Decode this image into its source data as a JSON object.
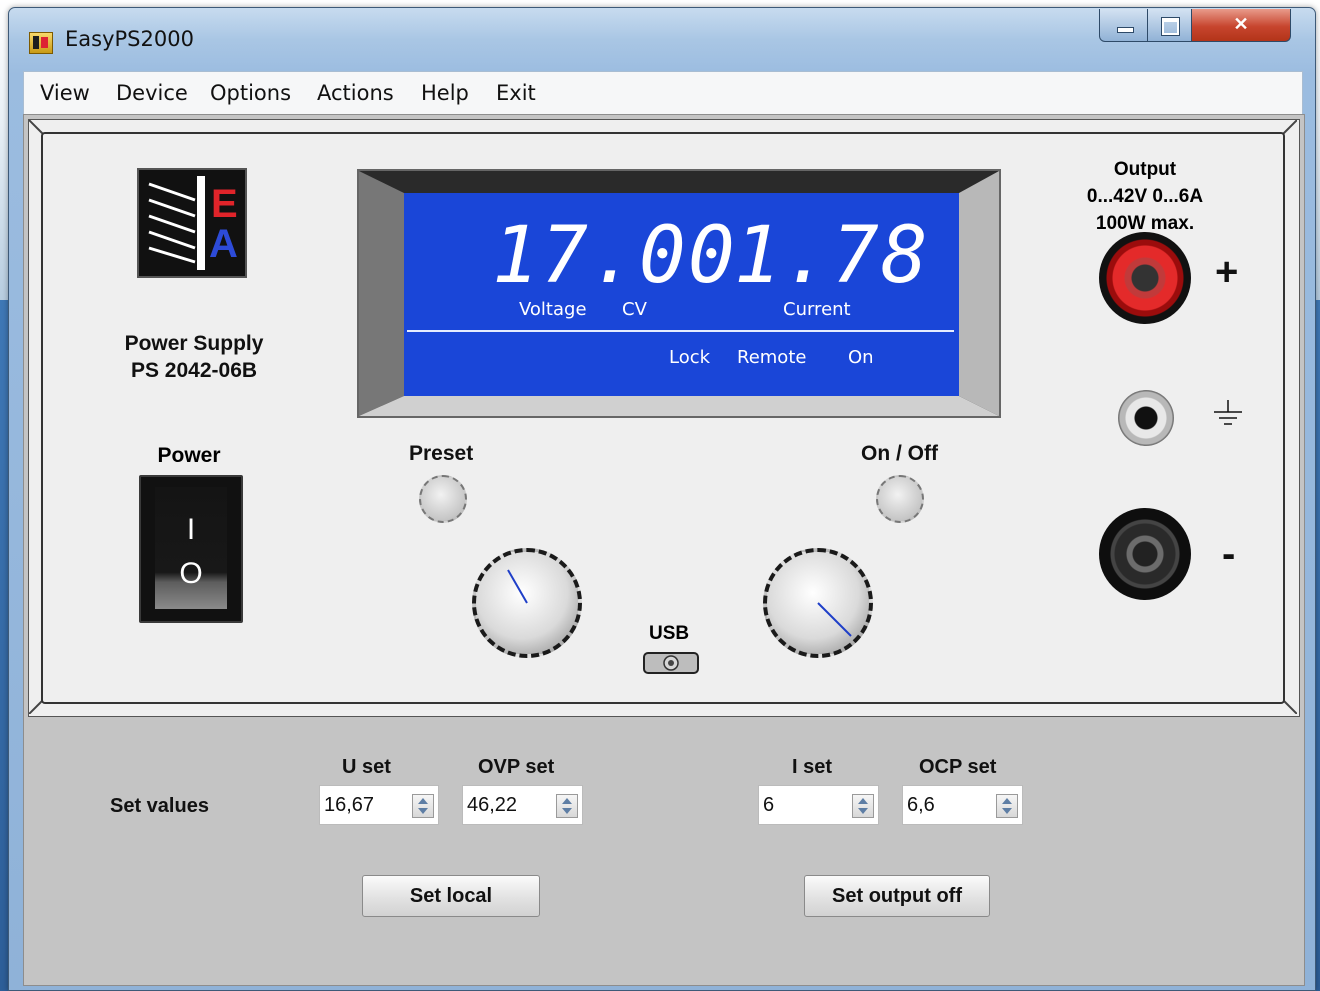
{
  "window": {
    "title": "EasyPS2000"
  },
  "menu": [
    "View",
    "Device",
    "Options",
    "Actions",
    "Help",
    "Exit"
  ],
  "device": {
    "brand_letters": {
      "top": "E",
      "bottom": "A"
    },
    "name_line1": "Power Supply",
    "name_line2": "PS 2042-06B",
    "power_label": "Power",
    "switch_on_symbol": "I",
    "switch_off_symbol": "O",
    "output_line1": "Output",
    "output_line2": "0...42V 0...6A",
    "output_line3": "100W max.",
    "plus_sign": "+",
    "minus_sign": "-",
    "preset_label": "Preset",
    "onoff_label": "On / Off",
    "usb_label": "USB"
  },
  "display": {
    "voltage": "17.00",
    "current": "1.78",
    "voltage_label": "Voltage",
    "mode_label": "CV",
    "current_label": "Current",
    "lock_label": "Lock",
    "remote_label": "Remote",
    "on_label": "On",
    "color": "#1a46d8"
  },
  "set_values": {
    "label": "Set values",
    "u_set_label": "U set",
    "u_set_value": "16,67",
    "ovp_set_label": "OVP set",
    "ovp_set_value": "46,22",
    "i_set_label": "I set",
    "i_set_value": "6",
    "ocp_set_label": "OCP set",
    "ocp_set_value": "6,6"
  },
  "buttons": {
    "set_local": "Set local",
    "set_output_off": "Set output off"
  }
}
